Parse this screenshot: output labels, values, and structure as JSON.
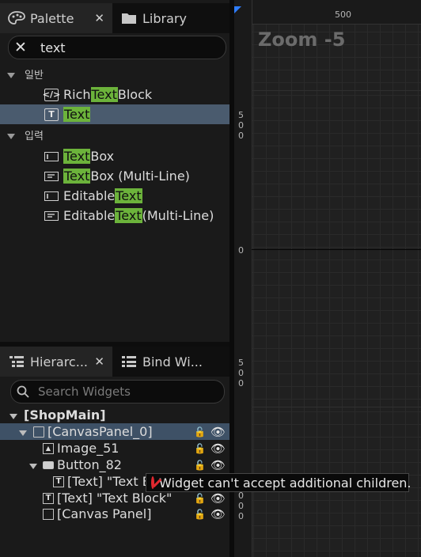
{
  "palette": {
    "tabs": [
      {
        "label": "Palette",
        "icon": "palette-icon",
        "close": "✕"
      },
      {
        "label": "Library",
        "icon": "folder-icon"
      }
    ],
    "search": {
      "value": "text",
      "clear": "✕"
    },
    "categories": [
      {
        "label": "일반",
        "items": [
          {
            "pre": "Rich ",
            "match": "Text",
            "post": " Block",
            "icon": "rich-text-block-icon"
          },
          {
            "pre": "",
            "match": "Text",
            "post": "",
            "icon": "text-block-icon",
            "selected": true
          }
        ]
      },
      {
        "label": "입력",
        "items": [
          {
            "pre": "",
            "match": "Text",
            "post": " Box",
            "icon": "text-box-icon"
          },
          {
            "pre": "",
            "match": "Text",
            "post": " Box (Multi-Line)",
            "icon": "multiline-text-box-icon"
          },
          {
            "pre": "Editable ",
            "match": "Text",
            "post": "",
            "icon": "editable-text-icon"
          },
          {
            "pre": "Editable ",
            "match": "Text",
            "post": " (Multi-Line)",
            "icon": "editable-multiline-text-icon"
          }
        ]
      }
    ]
  },
  "hierarchy": {
    "tabs": [
      {
        "label": "Hierarc...",
        "icon": "hierarchy-icon",
        "close": "✕"
      },
      {
        "label": "Bind Wi...",
        "icon": "bind-widgets-icon"
      }
    ],
    "search_placeholder": "Search Widgets",
    "tree": [
      {
        "label": "[ShopMain]"
      },
      {
        "label": "[CanvasPanel_0]"
      },
      {
        "label": "Image_51"
      },
      {
        "label": "Button_82"
      },
      {
        "label": "[Text] \"Text B"
      },
      {
        "label": "[Text] \"Text Block\""
      },
      {
        "label": "[Canvas Panel]"
      }
    ]
  },
  "canvas": {
    "zoom_label": "Zoom -5",
    "ruler_top": [
      "500"
    ],
    "ruler_left": [
      "5\n0\n0",
      "0",
      "5\n0\n0",
      "0\n0\n0"
    ]
  },
  "tooltip": {
    "text": "Widget can't accept additional children."
  },
  "colors": {
    "highlight": "#6cb33b",
    "selection": "#4a5b6e",
    "error": "#e0282f",
    "accent": "#2e7dff"
  }
}
